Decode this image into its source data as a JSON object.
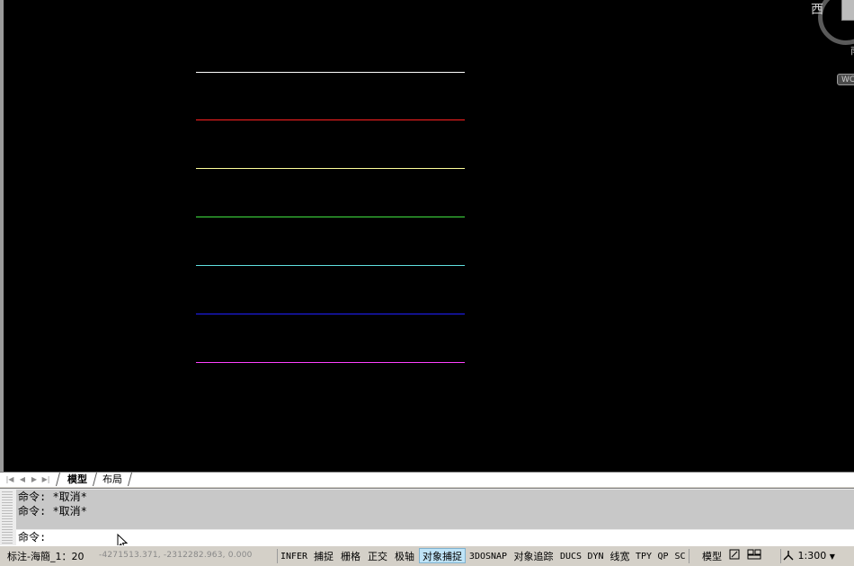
{
  "viewcube": {
    "west": "西",
    "south": "南",
    "wcs": "WCS"
  },
  "lines": [
    {
      "color": "#ffffff"
    },
    {
      "color": "#ff2020"
    },
    {
      "color": "#ffff9c"
    },
    {
      "color": "#40e040"
    },
    {
      "color": "#60e0e0"
    },
    {
      "color": "#2020ff"
    },
    {
      "color": "#ff40ff"
    }
  ],
  "tabs": {
    "model": "模型",
    "layout": "布局"
  },
  "command": {
    "history": [
      "命令: *取消*",
      "命令: *取消*"
    ],
    "prompt": "命令:"
  },
  "status": {
    "style": "标注-海簡_1：20",
    "coords": "-4271513.371, -2312282.963, 0.000",
    "buttons": [
      {
        "label": "INFER",
        "on": false,
        "mono": true
      },
      {
        "label": "捕捉",
        "on": false,
        "mono": false
      },
      {
        "label": "栅格",
        "on": false,
        "mono": false
      },
      {
        "label": "正交",
        "on": false,
        "mono": false
      },
      {
        "label": "极轴",
        "on": false,
        "mono": false
      },
      {
        "label": "对象捕捉",
        "on": true,
        "mono": false
      },
      {
        "label": "3DOSNAP",
        "on": false,
        "mono": true
      },
      {
        "label": "对象追踪",
        "on": false,
        "mono": false
      },
      {
        "label": "DUCS",
        "on": false,
        "mono": true
      },
      {
        "label": "DYN",
        "on": false,
        "mono": true
      },
      {
        "label": "线宽",
        "on": false,
        "mono": false
      },
      {
        "label": "TPY",
        "on": false,
        "mono": true
      },
      {
        "label": "QP",
        "on": false,
        "mono": true
      },
      {
        "label": "SC",
        "on": false,
        "mono": true
      }
    ],
    "model_label": "模型",
    "scale": "1:300"
  }
}
